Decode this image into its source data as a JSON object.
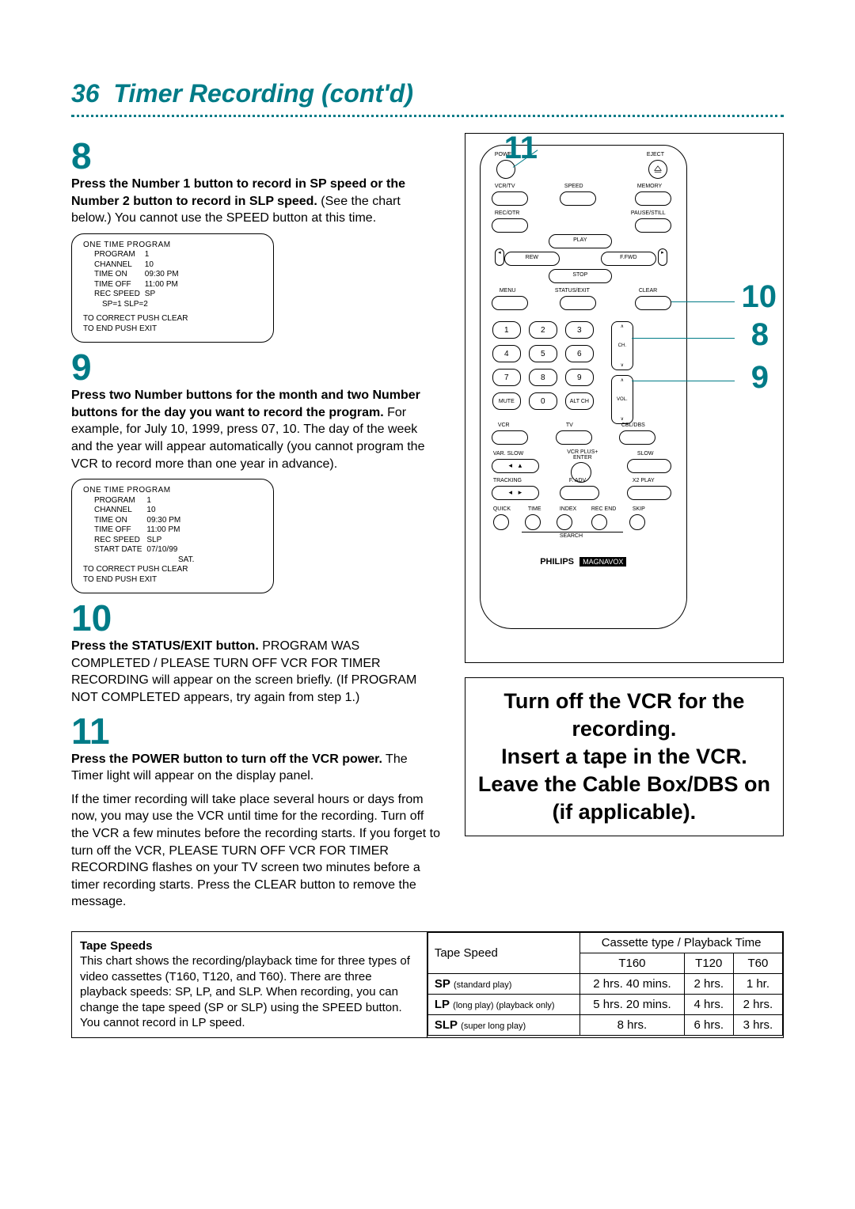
{
  "page": {
    "number": "36",
    "title": "Timer Recording (cont'd)"
  },
  "steps": {
    "s8": {
      "num": "8",
      "bold": "Press the Number 1 button to record in SP speed or the Number 2 button to record in SLP speed.",
      "rest": " (See the chart below.) You cannot use the SPEED button at this time."
    },
    "s9": {
      "num": "9",
      "bold": "Press two Number buttons for the month and two Number buttons for the day you want to record the program.",
      "rest": " For example, for July 10, 1999, press 07, 10. The day of the week and the year will appear automatically (you cannot program the VCR to record more than one year in advance)."
    },
    "s10": {
      "num": "10",
      "bold": "Press the STATUS/EXIT button.",
      "rest": " PROGRAM WAS COMPLETED / PLEASE TURN OFF VCR FOR TIMER RECORDING will appear on the screen briefly. (If PROGRAM NOT COMPLETED appears, try again from step 1.)"
    },
    "s11": {
      "num": "11",
      "bold": "Press the POWER button to turn off the VCR power.",
      "rest": " The Timer light will appear on the display panel.",
      "para2": "If the timer recording will take place several hours or days from now, you may use the VCR until time for the recording. Turn off the VCR a few minutes before the recording starts. If you forget to turn off the VCR, PLEASE TURN OFF VCR FOR TIMER RECORDING flashes on your TV screen two minutes before a timer recording starts. Press the CLEAR button to remove the message."
    }
  },
  "osd1": {
    "title": "ONE TIME PROGRAM",
    "rows": [
      [
        "PROGRAM",
        "1"
      ],
      [
        "CHANNEL",
        "10"
      ],
      [
        "TIME ON",
        "09:30 PM"
      ],
      [
        "TIME OFF",
        "11:00 PM"
      ],
      [
        "REC SPEED",
        "SP"
      ]
    ],
    "speeds": "SP=1    SLP=2",
    "foot1": "TO CORRECT PUSH CLEAR",
    "foot2": "TO END PUSH EXIT"
  },
  "osd2": {
    "title": "ONE TIME PROGRAM",
    "rows": [
      [
        "PROGRAM",
        "1"
      ],
      [
        "CHANNEL",
        "10"
      ],
      [
        "TIME ON",
        "09:30 PM"
      ],
      [
        "TIME OFF",
        "11:00 PM"
      ],
      [
        "REC SPEED",
        "SLP"
      ],
      [
        "START DATE",
        "07/10/99"
      ]
    ],
    "day": "SAT.",
    "foot1": "TO CORRECT PUSH CLEAR",
    "foot2": "TO END PUSH EXIT"
  },
  "remote": {
    "power": "POWER",
    "eject": "EJECT",
    "vcrtv": "VCR/TV",
    "speed": "SPEED",
    "memory": "MEMORY",
    "recotr": "REC/OTR",
    "pause": "PAUSE/STILL",
    "play": "PLAY",
    "rew": "REW",
    "ffwd": "F.FWD",
    "stop": "STOP",
    "menu": "MENU",
    "status": "STATUS/EXIT",
    "clear": "CLEAR",
    "mute": "MUTE",
    "altch": "ALT CH",
    "ch": "CH.",
    "vol": "VOL.",
    "vcr": "VCR",
    "tv": "TV",
    "cbl": "CBL/DBS",
    "varslow": "VAR. SLOW",
    "slow": "SLOW",
    "vcrplus": "VCR PLUS+\nENTER",
    "tracking": "TRACKING",
    "fadv": "F. ADV",
    "x2play": "X2 PLAY",
    "quick": "QUICK",
    "time": "TIME",
    "index": "INDEX",
    "recend": "REC END",
    "skip": "SKIP",
    "search": "SEARCH",
    "brand": "PHILIPS",
    "brand2": "MAGNAVOX"
  },
  "callouts": {
    "c11": "11",
    "c10": "10",
    "c8": "8",
    "c9": "9"
  },
  "bigmsg": {
    "l1": "Turn off the VCR for the recording.",
    "l2": "Insert a tape in the VCR.",
    "l3": "Leave the Cable Box/DBS on (if applicable)."
  },
  "tape": {
    "heading": "Tape Speeds",
    "desc": "This chart shows the recording/playback time for three types of video cassettes (T160, T120, and T60). There are three playback speeds: SP, LP, and SLP. When recording, you can change the tape speed (SP or SLP) using the SPEED button. You cannot record in LP speed.",
    "colhead_top": "Cassette type / Playback Time",
    "colhead_speed": "Tape Speed",
    "cols": [
      "T160",
      "T120",
      "T60"
    ],
    "rows": [
      {
        "label": "SP",
        "sub": "(standard play)",
        "vals": [
          "2 hrs. 40 mins.",
          "2 hrs.",
          "1 hr."
        ]
      },
      {
        "label": "LP",
        "sub": "(long play) (playback only)",
        "vals": [
          "5 hrs. 20 mins.",
          "4 hrs.",
          "2 hrs."
        ]
      },
      {
        "label": "SLP",
        "sub": "(super long play)",
        "vals": [
          "8 hrs.",
          "6 hrs.",
          "3 hrs."
        ]
      }
    ]
  }
}
